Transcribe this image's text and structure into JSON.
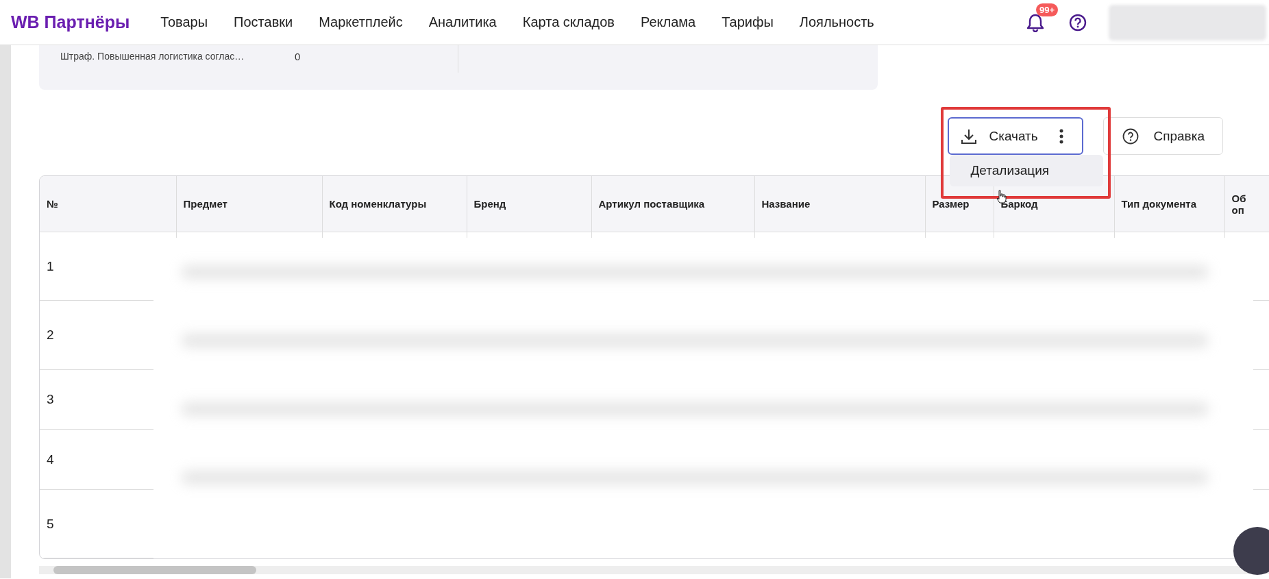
{
  "header": {
    "logo": "WB Партнёры",
    "nav": [
      "Товары",
      "Поставки",
      "Маркетплейс",
      "Аналитика",
      "Карта складов",
      "Реклама",
      "Тарифы",
      "Лояльность"
    ],
    "notifications_badge": "99+"
  },
  "summary": [
    {
      "label": "Штраф. Повышенная логистика соглас…",
      "value": "0"
    }
  ],
  "toolbar": {
    "download_button": "Скачать",
    "download_menu": [
      "Детализация"
    ],
    "help_button": "Справка"
  },
  "table": {
    "columns": [
      "№",
      "Предмет",
      "Код номенклатуры",
      "Бренд",
      "Артикул поставщика",
      "Название",
      "Размер",
      "Баркод",
      "Тип документа",
      "Об оп"
    ],
    "rows": [
      {
        "number": "1"
      },
      {
        "number": "2"
      },
      {
        "number": "3"
      },
      {
        "number": "4"
      },
      {
        "number": "5"
      }
    ]
  }
}
